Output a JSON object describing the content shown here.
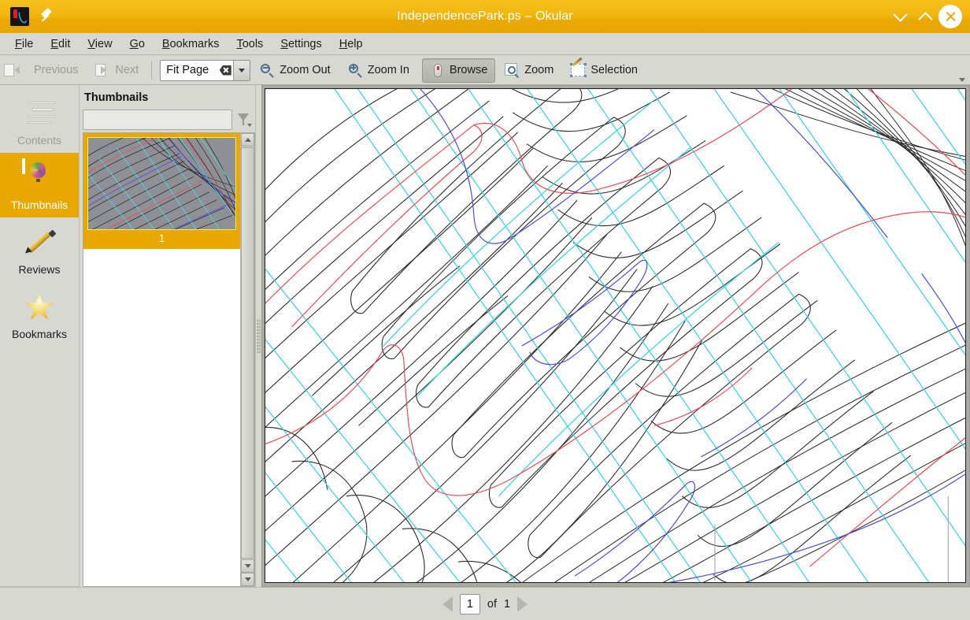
{
  "window": {
    "title": "IndependencePark.ps – Okular",
    "app_icon": "okular-icon",
    "pin": "pin-icon",
    "minimize": "chevron-down-icon",
    "maximize": "chevron-up-icon",
    "close": "close-icon",
    "titlebar_color": "#eda70a"
  },
  "menubar": {
    "items": [
      {
        "acc": "F",
        "rest": "ile"
      },
      {
        "acc": "E",
        "rest": "dit"
      },
      {
        "acc": "V",
        "rest": "iew"
      },
      {
        "acc": "G",
        "rest": "o"
      },
      {
        "acc": "B",
        "rest": "ookmarks"
      },
      {
        "acc": "T",
        "rest": "ools"
      },
      {
        "acc": "S",
        "rest": "ettings"
      },
      {
        "acc": "H",
        "rest": "elp"
      }
    ]
  },
  "toolbar": {
    "previous_label": "Previous",
    "next_label": "Next",
    "zoom_value": "Fit Page",
    "zoom_out_label": "Zoom Out",
    "zoom_in_label": "Zoom In",
    "browse_label": "Browse",
    "zoom_label": "Zoom",
    "selection_label": "Selection"
  },
  "sidebar": {
    "items": [
      {
        "label": "Contents",
        "icon": "contents-icon",
        "state": "disabled"
      },
      {
        "label": "Thumbnails",
        "icon": "thumbnails-icon",
        "state": "selected"
      },
      {
        "label": "Reviews",
        "icon": "pencil-icon",
        "state": "normal"
      },
      {
        "label": "Bookmarks",
        "icon": "star-icon",
        "state": "normal"
      }
    ],
    "selected_color": "#e8a800"
  },
  "thumbnails": {
    "title": "Thumbnails",
    "search_value": "",
    "search_placeholder": "",
    "filter_icon": "filter-funnel-icon",
    "pages": [
      {
        "number": "1"
      }
    ]
  },
  "statusbar": {
    "prev_icon": "triangle-left-icon",
    "next_icon": "triangle-right-icon",
    "page_value": "1",
    "of_label": "of",
    "total_pages": "1"
  },
  "chart_data": {
    "type": "line",
    "title": "",
    "xlabel": "",
    "ylabel": "",
    "description": "Dense contour / characteristic-line plot on white page; families of smooth wavy black contour curves running lower-left to upper-right, overlaid by straight cyan diagonal rays, with occasional red and blue highlighted contour levels.",
    "series": [
      {
        "name": "contour-black",
        "color": "#2b2b2b",
        "count": 46
      },
      {
        "name": "ray-cyan",
        "color": "#35d6e8",
        "count": 17
      },
      {
        "name": "contour-red",
        "color": "#f0484f",
        "count": 6
      },
      {
        "name": "contour-blue",
        "color": "#4a4ae0",
        "count": 6
      }
    ],
    "grid": false,
    "legend": "none"
  }
}
